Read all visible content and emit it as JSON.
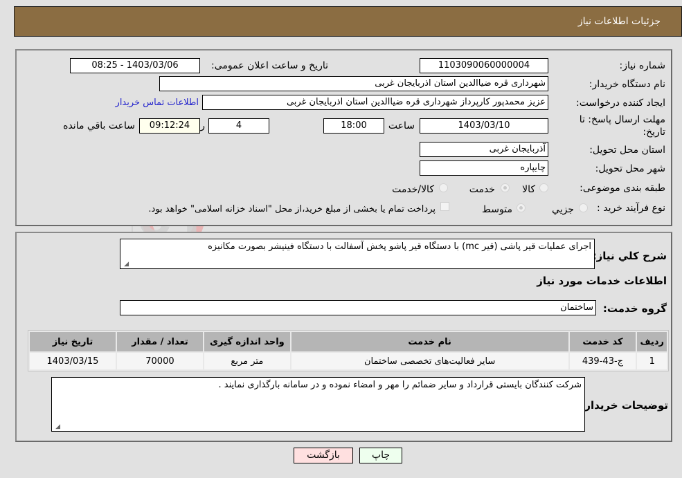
{
  "header": {
    "title": "جزئیات اطلاعات نیاز"
  },
  "form": {
    "need_number": {
      "label": "شماره نیاز:",
      "value": "1103090060000004"
    },
    "announce_datetime": {
      "label": "تاریخ و ساعت اعلان عمومی:",
      "value": "1403/03/06 - 08:25"
    },
    "buyer_org": {
      "label": "نام دستگاه خریدار:",
      "value": "شهرداری قره ضیاالدین استان اذربایجان غربی"
    },
    "requester": {
      "label": "ایجاد کننده درخواست:",
      "value": "عزیز محمدپور کارپرداز شهرداری قره ضیاالدین استان اذربایجان غربی"
    },
    "buyer_contact_link": "اطلاعات تماس خریدار",
    "deadline": {
      "label_line1": "مهلت ارسال پاسخ: تا",
      "label_line2": "تاریخ:",
      "date": "1403/03/10",
      "time_label": "ساعت",
      "time": "18:00",
      "days": "4",
      "days_label": "روز و",
      "remaining": "09:12:24",
      "remaining_label": "ساعت باقي مانده"
    },
    "delivery_province": {
      "label": "استان محل تحویل:",
      "value": "آذربایجان غربی"
    },
    "delivery_city": {
      "label": "شهر محل تحویل:",
      "value": "چایپاره"
    },
    "category": {
      "label": "طبقه بندی موضوعی:",
      "options": [
        "کالا",
        "خدمت",
        "کالا/خدمت"
      ],
      "selected": "خدمت"
    },
    "purchase_type": {
      "label": "نوع فرآیند خرید :",
      "options": [
        "جزیي",
        "متوسط"
      ],
      "selected": "متوسط",
      "treasury_note": "پرداخت تمام یا بخشی از مبلغ خرید،از محل \"اسناد خزانه اسلامی\" خواهد بود."
    }
  },
  "details": {
    "description_label": "شرح کلي نیاز:",
    "description": "اجرای عملیات قیر پاشی (قیر mc) با دستگاه قیر پاشو پخش آسفالت با دستگاه فینیشر بصورت مکانیزه",
    "services_title": "اطلاعات خدمات مورد نیاز",
    "service_group_label": "گروه خدمت:",
    "service_group": "ساختمان",
    "table": {
      "headers": [
        "ردیف",
        "کد خدمت",
        "نام خدمت",
        "واحد اندازه گیری",
        "تعداد / مقدار",
        "تاریخ نیاز"
      ],
      "rows": [
        [
          "1",
          "ج-43-439",
          "سایر فعالیت‌های تخصصی ساختمان",
          "متر مربع",
          "70000",
          "1403/03/15"
        ]
      ]
    },
    "buyer_notes_label": "توضیحات خریدار:",
    "buyer_notes": "شرکت کنندگان بایستی قرارداد و سایر ضمائم را مهر و امضاء نموده و در سامانه بارگذاری نمایند ."
  },
  "buttons": {
    "print": "چاپ",
    "back": "بازگشت"
  },
  "colors": {
    "header_bg": "#8b6d42",
    "print_bg": "#eeffee",
    "back_bg": "#ffe0e0",
    "link": "#2222cc"
  },
  "watermark": "AriaTender.neT"
}
